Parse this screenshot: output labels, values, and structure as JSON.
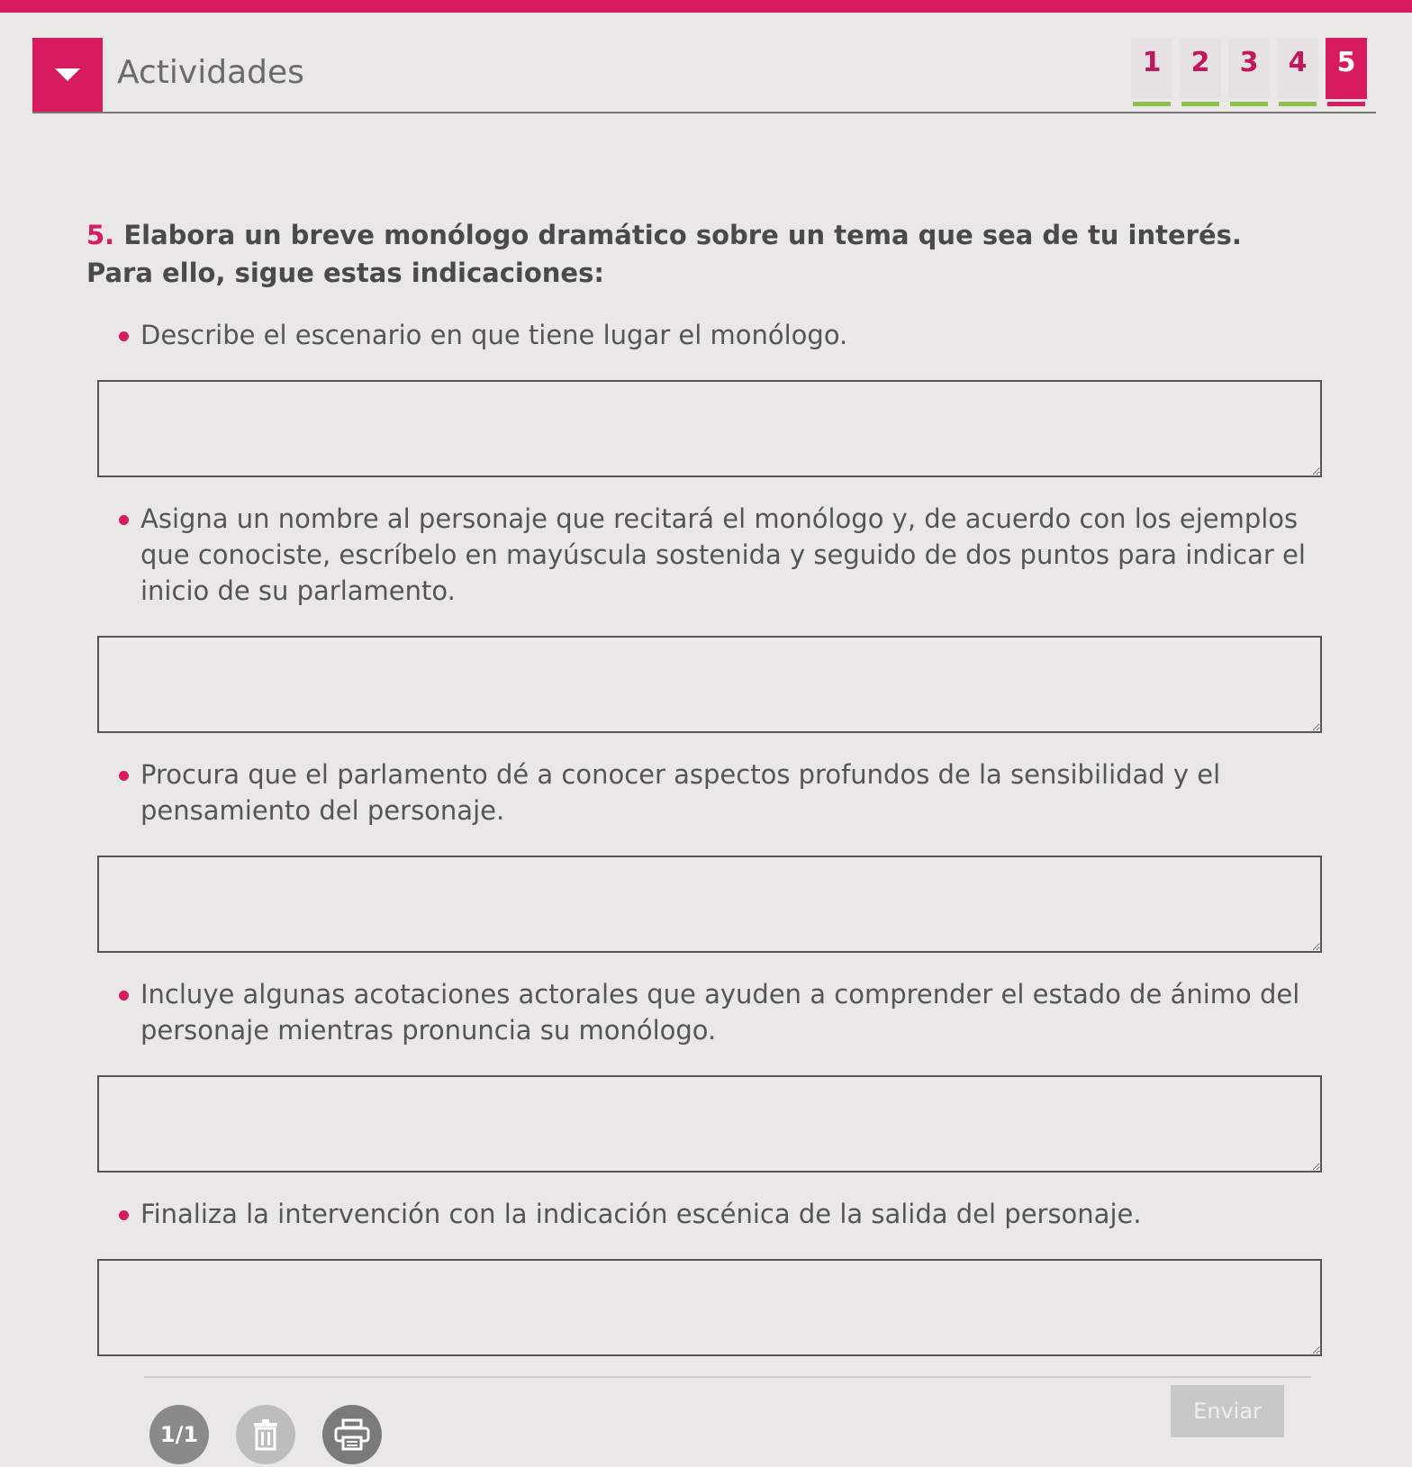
{
  "header": {
    "title": "Actividades",
    "steps": [
      {
        "label": "1",
        "indicator_color": "#8bc34a"
      },
      {
        "label": "2",
        "indicator_color": "#8bc34a"
      },
      {
        "label": "3",
        "indicator_color": "#8bc34a"
      },
      {
        "label": "4",
        "indicator_color": "#8bc34a"
      },
      {
        "label": "5",
        "indicator_color": "#d81b60"
      }
    ],
    "active_step": "5"
  },
  "question": {
    "number": "5.",
    "text": "Elabora un breve monólogo dramático sobre un tema que sea de tu interés. Para ello, sigue estas indicaciones:"
  },
  "items": [
    {
      "instruction": "Describe el escenario en que tiene lugar el monólogo.",
      "answer": ""
    },
    {
      "instruction": "Asigna un nombre al personaje que recitará el monólogo y, de acuerdo con los ejemplos que conociste, escríbelo en mayúscula sostenida y seguido de dos puntos para indicar el inicio de su parlamento.",
      "answer": ""
    },
    {
      "instruction": "Procura que el parlamento dé a conocer aspectos profundos de la sensibilidad y el pensamiento del personaje.",
      "answer": ""
    },
    {
      "instruction": "Incluye algunas acotaciones actorales que ayuden a comprender el estado de ánimo del personaje mientras pronuncia su monólogo.",
      "answer": ""
    },
    {
      "instruction": "Finaliza la intervención con la indicación escénica de la salida del personaje.",
      "answer": ""
    }
  ],
  "footer": {
    "page_indicator": "1/1",
    "delete_icon": "trash-icon",
    "print_icon": "printer-icon",
    "send_label": "Enviar"
  },
  "colors": {
    "accent": "#d81b60",
    "completed": "#8bc34a"
  }
}
